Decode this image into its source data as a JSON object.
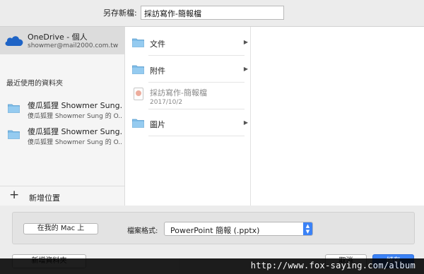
{
  "save_as": {
    "label": "另存新檔:",
    "value": "採訪寫作-簡報檔"
  },
  "sidebar": {
    "account": {
      "name": "OneDrive - 個人",
      "email": "showmer@mail2000.com.tw"
    },
    "recent_header": "最近使用的資料夾",
    "recent": [
      {
        "title": "傻瓜狐狸 Showmer Sung...",
        "subtitle": "傻瓜狐狸 Showmer Sung 的 O..."
      },
      {
        "title": "傻瓜狐狸 Showmer Sung...",
        "subtitle": "傻瓜狐狸 Showmer Sung 的 O..."
      }
    ],
    "add_place": "新增位置"
  },
  "files": {
    "items": [
      {
        "label": "文件",
        "type": "folder"
      },
      {
        "label": "附件",
        "type": "folder"
      },
      {
        "label": "採訪寫作-簡報檔",
        "date": "2017/10/2",
        "type": "file"
      },
      {
        "label": "圖片",
        "type": "folder"
      }
    ]
  },
  "options": {
    "on_my_mac": "在我的 Mac 上",
    "format_label": "檔案格式:",
    "format_value": "PowerPoint 簡報 (.pptx)"
  },
  "buttons": {
    "new_folder": "新增資料夾",
    "cancel": "取消",
    "save": "儲存"
  },
  "watermark": "http://www.fox-saying.com/album",
  "colors": {
    "accent": "#3b82f6",
    "folder": "#7fbde8",
    "onedrive": "#1f64c6"
  }
}
